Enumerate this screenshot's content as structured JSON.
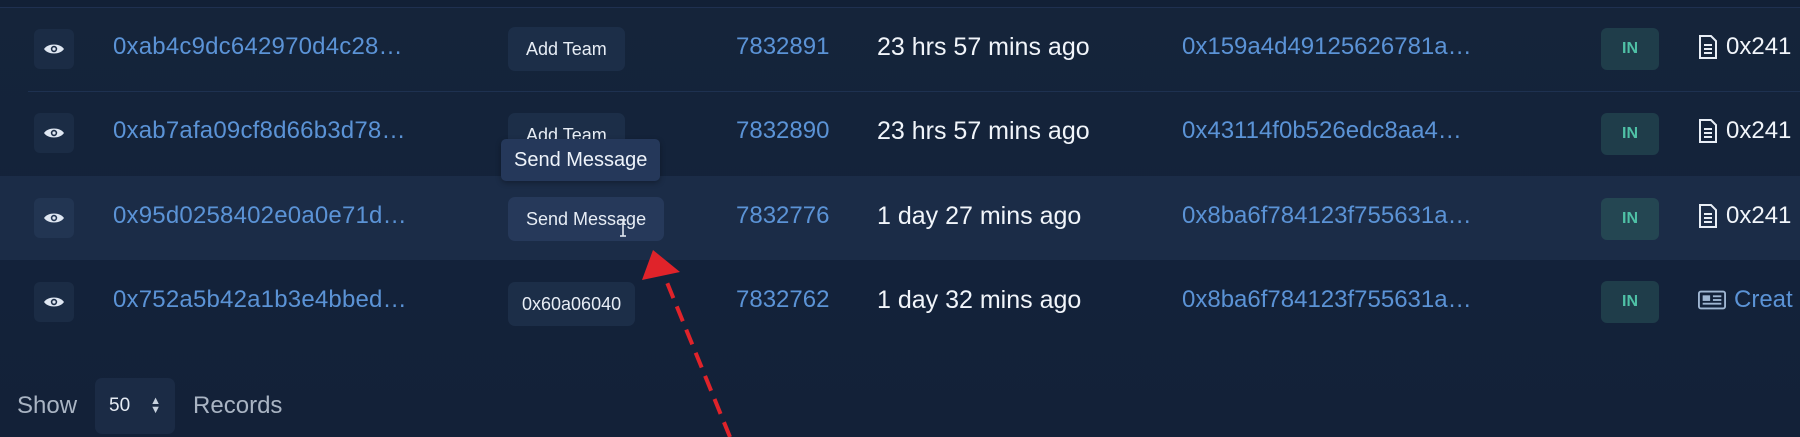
{
  "rows": [
    {
      "tx_hash": "0xab4c9dc642970d4c28…",
      "method": "Add Team",
      "block": "7832891",
      "age": "23 hrs 57 mins ago",
      "from": "0x159a4d49125626781a…",
      "direction": "IN",
      "to": "0x241",
      "to_icon": "document-icon"
    },
    {
      "tx_hash": "0xab7afa09cf8d66b3d78…",
      "method": "Add Team",
      "block": "7832890",
      "age": "23 hrs 57 mins ago",
      "from": "0x43114f0b526edc8aa4…",
      "direction": "IN",
      "to": "0x241",
      "to_icon": "document-icon"
    },
    {
      "tx_hash": "0x95d0258402e0a0e71d…",
      "method": "Send Message",
      "block": "7832776",
      "age": "1 day 27 mins ago",
      "from": "0x8ba6f784123f755631a…",
      "direction": "IN",
      "to": "0x241",
      "to_icon": "document-icon"
    },
    {
      "tx_hash": "0x752a5b42a1b3e4bbed…",
      "method": "0x60a06040",
      "block": "7832762",
      "age": "1 day 32 mins ago",
      "from": "0x8ba6f784123f755631a…",
      "direction": "IN",
      "to": "Creat",
      "to_icon": "contract-create-icon"
    }
  ],
  "tooltip": {
    "text": "Send Message"
  },
  "footer": {
    "show_label": "Show",
    "page_size": "50",
    "records_label": "Records"
  },
  "colors": {
    "background": "#142339",
    "link": "#5b93d6",
    "text": "#f1f5fa",
    "direction_badge": "#4fc1a6",
    "annotation_arrow": "#e0232a"
  }
}
